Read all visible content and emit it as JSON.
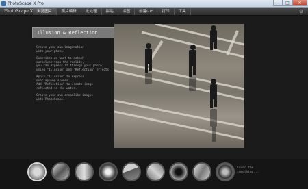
{
  "window": {
    "title": "PhotoScape X Pro",
    "minimize": "–",
    "maximize": "□",
    "close": "✕"
  },
  "app": {
    "brand": "PhotoScape X"
  },
  "menu": {
    "items": [
      "浏览图片",
      "照片编辑",
      "批处理",
      "拼贴",
      "拼图",
      "创建GIF",
      "打印",
      "工具"
    ],
    "active_index": 0
  },
  "settings_icon": "gear-icon",
  "main": {
    "title": "Illusion & Reflection",
    "paragraphs": [
      "Create your own imagination\nwith your photo.",
      "Sometimes we want to detach\nourselves from the reality,\nyou can express it through your photo\nusing \"Illusion\" and \"Reflection\" effects.",
      "Apply \"Illusion\" to express\noverlapping scenes.\nAdd \"Reflection\" to create image\nreflected in the water.",
      "Create your own dreamlike images\nwith PhotoScape."
    ]
  },
  "thumbnails": {
    "count": 9,
    "selected_index": 0,
    "caption": "Cover the\nsomething..."
  },
  "colors": {
    "accent": "#7a7a7a",
    "background": "#1b1b1b"
  }
}
